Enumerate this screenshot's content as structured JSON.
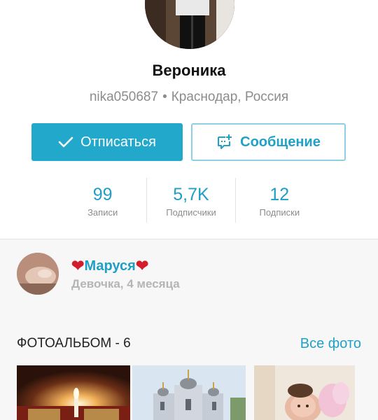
{
  "profile": {
    "name": "Вероника",
    "username": "nika050687",
    "location": "Краснодар, Россия",
    "separator": "•"
  },
  "actions": {
    "unsubscribe_label": "Отписаться",
    "message_label": "Сообщение"
  },
  "stats": [
    {
      "value": "99",
      "label": "Записи"
    },
    {
      "value": "5,7K",
      "label": "Подписчики"
    },
    {
      "value": "12",
      "label": "Подписки"
    }
  ],
  "child": {
    "name": "Маруся",
    "description": "Девочка, 4 месяца"
  },
  "album": {
    "title": "ФОТОАЛЬБОМ - 6",
    "all_label": "Все фото"
  },
  "colors": {
    "accent": "#21a8cb",
    "link": "#1fa2c6",
    "muted": "#8c8c8c",
    "heart": "#d41d2c"
  }
}
